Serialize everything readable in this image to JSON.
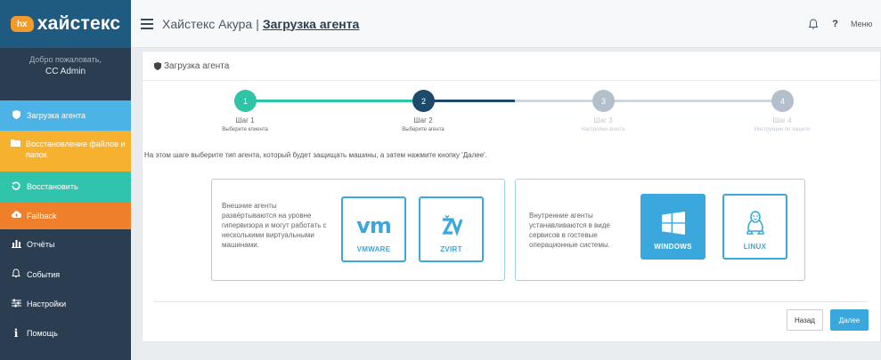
{
  "brand": {
    "badge": "hx",
    "name": "хайстекс"
  },
  "user": {
    "greeting": "Добро пожаловать,",
    "name": "CC Admin"
  },
  "sidebar": {
    "items": [
      {
        "label": "Загрузка агента",
        "icon": "shield-icon",
        "color": "#4bb3e6"
      },
      {
        "label": "Восстановление файлов и папок",
        "icon": "folder-icon",
        "color": "#f6b12f"
      },
      {
        "label": "Восстановить",
        "icon": "restore-icon",
        "color": "#31c4ac"
      },
      {
        "label": "Failback",
        "icon": "cloud-upload-icon",
        "color": "#f07f2c"
      },
      {
        "label": "Отчёты",
        "icon": "bar-chart-icon",
        "color": "#2b3d50"
      },
      {
        "label": "События",
        "icon": "bell-icon",
        "color": "#2b3d50"
      },
      {
        "label": "Настройки",
        "icon": "sliders-icon",
        "color": "#2b3d50"
      },
      {
        "label": "Помощь",
        "icon": "info-icon",
        "color": "#2b3d50"
      }
    ]
  },
  "header": {
    "app": "Хайстекс Акура",
    "separator": "|",
    "current": "Загрузка агента",
    "help": "?",
    "menu": "Меню"
  },
  "panel": {
    "title": "Загрузка агента"
  },
  "steps": [
    {
      "number": "1",
      "title": "Шаг 1",
      "subtitle": "Выберите клиента",
      "state": "done"
    },
    {
      "number": "2",
      "title": "Шаг 2",
      "subtitle": "Выберите агента",
      "state": "active"
    },
    {
      "number": "3",
      "title": "Шаг 3",
      "subtitle": "Настройки агента",
      "state": "pending"
    },
    {
      "number": "4",
      "title": "Шаг 4",
      "subtitle": "Инструкции по защите",
      "state": "pending"
    }
  ],
  "instruction": "На этом шаге выберите тип агента, который будет защищать машины, а затем нажмите кнопку 'Далее'.",
  "external": {
    "description": "Внешние агенты развёртываются на уровне гипервизора и могут работать с несколькими виртуальными машинами.",
    "agents": [
      {
        "label": "VMWARE",
        "icon": "vmware-logo-icon",
        "logo_text": "vm",
        "selected": false
      },
      {
        "label": "ZVIRT",
        "icon": "zvirt-logo-icon",
        "selected": false
      }
    ]
  },
  "internal": {
    "description": "Внутренние агенты устанавливаются в виде сервисов в гостевые операционные системы.",
    "agents": [
      {
        "label": "WINDOWS",
        "icon": "windows-logo-icon",
        "selected": true
      },
      {
        "label": "LINUX",
        "icon": "linux-tux-icon",
        "selected": false
      }
    ]
  },
  "buttons": {
    "back": "Назад",
    "next": "Далее"
  },
  "colors": {
    "accent": "#3aa8dc",
    "step_done": "#2ec4a6",
    "step_active": "#1d4a6a",
    "step_pending": "#b3c0cc",
    "sidebar_bg": "#2b3d50"
  }
}
